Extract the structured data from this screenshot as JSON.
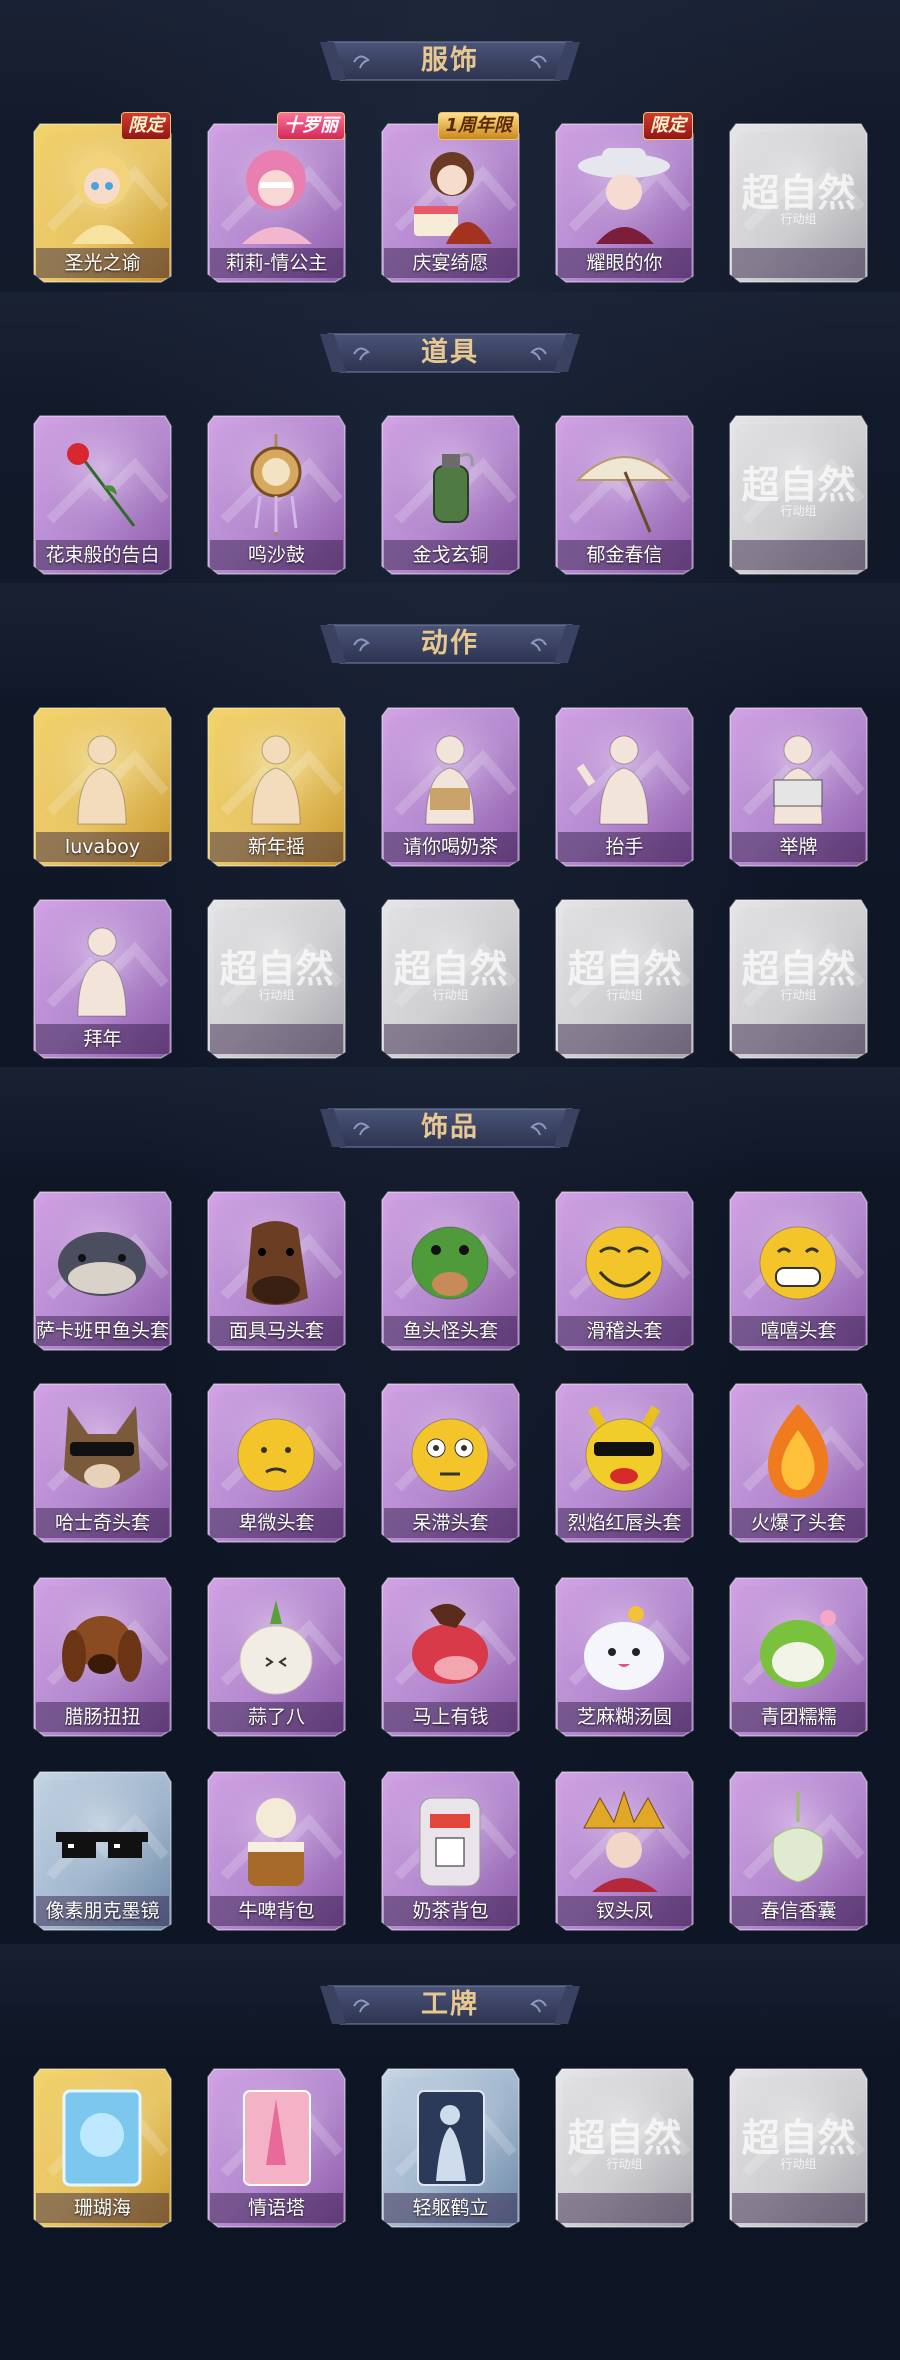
{
  "colors": {
    "background": "#101827",
    "banner_fill": "#3c4566",
    "banner_text": "#e7c890",
    "gold_frame": "#d7b444",
    "purple_frame": "#a57ac2",
    "blue_frame": "#8fa6c0",
    "silver_frame": "#bdbdc2"
  },
  "placeholder": {
    "logo": "超自然",
    "sub": "行动组"
  },
  "sections": [
    {
      "title": "服饰",
      "items": [
        {
          "name": "圣光之谕",
          "frame": "gold",
          "icon": "saint-costume-icon",
          "badge": "限定"
        },
        {
          "name": "莉莉-情公主",
          "frame": "purple",
          "icon": "pink-princess-icon",
          "badge": "十罗丽"
        },
        {
          "name": "庆宴绮愿",
          "frame": "purple",
          "icon": "party-cake-girl-icon",
          "badge": "1周年限"
        },
        {
          "name": "耀眼的你",
          "frame": "purple",
          "icon": "cowgirl-hat-icon",
          "badge": "限定"
        },
        {
          "name": "",
          "frame": "silver",
          "icon": "placeholder-logo-icon"
        }
      ]
    },
    {
      "title": "道具",
      "items": [
        {
          "name": "花束般的告白",
          "frame": "purple",
          "icon": "rose-icon"
        },
        {
          "name": "鸣沙鼓",
          "frame": "purple",
          "icon": "drum-icon"
        },
        {
          "name": "金戈玄铜",
          "frame": "purple",
          "icon": "grenade-icon"
        },
        {
          "name": "郁金春信",
          "frame": "purple",
          "icon": "paper-umbrella-icon"
        },
        {
          "name": "",
          "frame": "silver",
          "icon": "placeholder-logo-icon"
        }
      ]
    },
    {
      "title": "动作",
      "items": [
        {
          "name": "luvaboy",
          "frame": "gold",
          "icon": "pose-heart-icon"
        },
        {
          "name": "新年摇",
          "frame": "gold",
          "icon": "pose-shake-icon"
        },
        {
          "name": "请你喝奶茶",
          "frame": "purple",
          "icon": "pose-milk-tea-icon"
        },
        {
          "name": "抬手",
          "frame": "purple",
          "icon": "pose-raise-hand-icon"
        },
        {
          "name": "举牌",
          "frame": "purple",
          "icon": "pose-hold-sign-icon"
        },
        {
          "name": "拜年",
          "frame": "purple",
          "icon": "pose-greeting-icon"
        },
        {
          "name": "",
          "frame": "silver",
          "icon": "placeholder-logo-icon"
        },
        {
          "name": "",
          "frame": "silver",
          "icon": "placeholder-logo-icon"
        },
        {
          "name": "",
          "frame": "silver",
          "icon": "placeholder-logo-icon"
        },
        {
          "name": "",
          "frame": "silver",
          "icon": "placeholder-logo-icon"
        }
      ]
    },
    {
      "title": "饰品",
      "items": [
        {
          "name": "萨卡班甲鱼头套",
          "frame": "purple",
          "icon": "fish-head-icon"
        },
        {
          "name": "面具马头套",
          "frame": "purple",
          "icon": "horse-head-icon"
        },
        {
          "name": "鱼头怪头套",
          "frame": "purple",
          "icon": "frog-fish-head-icon"
        },
        {
          "name": "滑稽头套",
          "frame": "purple",
          "icon": "funny-face-icon"
        },
        {
          "name": "嘻嘻头套",
          "frame": "purple",
          "icon": "grin-face-icon"
        },
        {
          "name": "哈士奇头套",
          "frame": "purple",
          "icon": "husky-head-icon"
        },
        {
          "name": "卑微头套",
          "frame": "purple",
          "icon": "humble-face-icon"
        },
        {
          "name": "呆滞头套",
          "frame": "purple",
          "icon": "dazed-face-icon"
        },
        {
          "name": "烈焰红唇头套",
          "frame": "purple",
          "icon": "pikachu-lips-icon"
        },
        {
          "name": "火爆了头套",
          "frame": "purple",
          "icon": "fire-face-icon"
        },
        {
          "name": "腊肠扭扭",
          "frame": "purple",
          "icon": "dachshund-icon"
        },
        {
          "name": "蒜了八",
          "frame": "purple",
          "icon": "garlic-icon"
        },
        {
          "name": "马上有钱",
          "frame": "purple",
          "icon": "red-horse-icon"
        },
        {
          "name": "芝麻糊汤圆",
          "frame": "purple",
          "icon": "dumpling-icon"
        },
        {
          "name": "青团糯糯",
          "frame": "purple",
          "icon": "green-rice-ball-icon"
        },
        {
          "name": "像素朋克墨镜",
          "frame": "blue",
          "icon": "pixel-sunglasses-icon"
        },
        {
          "name": "牛啤背包",
          "frame": "purple",
          "icon": "cow-beer-backpack-icon"
        },
        {
          "name": "奶茶背包",
          "frame": "purple",
          "icon": "milk-tea-backpack-icon"
        },
        {
          "name": "钗头凤",
          "frame": "purple",
          "icon": "phoenix-crown-icon"
        },
        {
          "name": "春信香囊",
          "frame": "purple",
          "icon": "sachet-icon"
        }
      ]
    },
    {
      "title": "工牌",
      "items": [
        {
          "name": "珊瑚海",
          "frame": "gold",
          "icon": "coral-sea-card-icon"
        },
        {
          "name": "情语塔",
          "frame": "purple",
          "icon": "love-tower-card-icon"
        },
        {
          "name": "轻躯鹤立",
          "frame": "blue",
          "icon": "silhouette-card-icon"
        },
        {
          "name": "",
          "frame": "silver",
          "icon": "placeholder-logo-icon"
        },
        {
          "name": "",
          "frame": "silver",
          "icon": "placeholder-logo-icon"
        }
      ]
    }
  ]
}
